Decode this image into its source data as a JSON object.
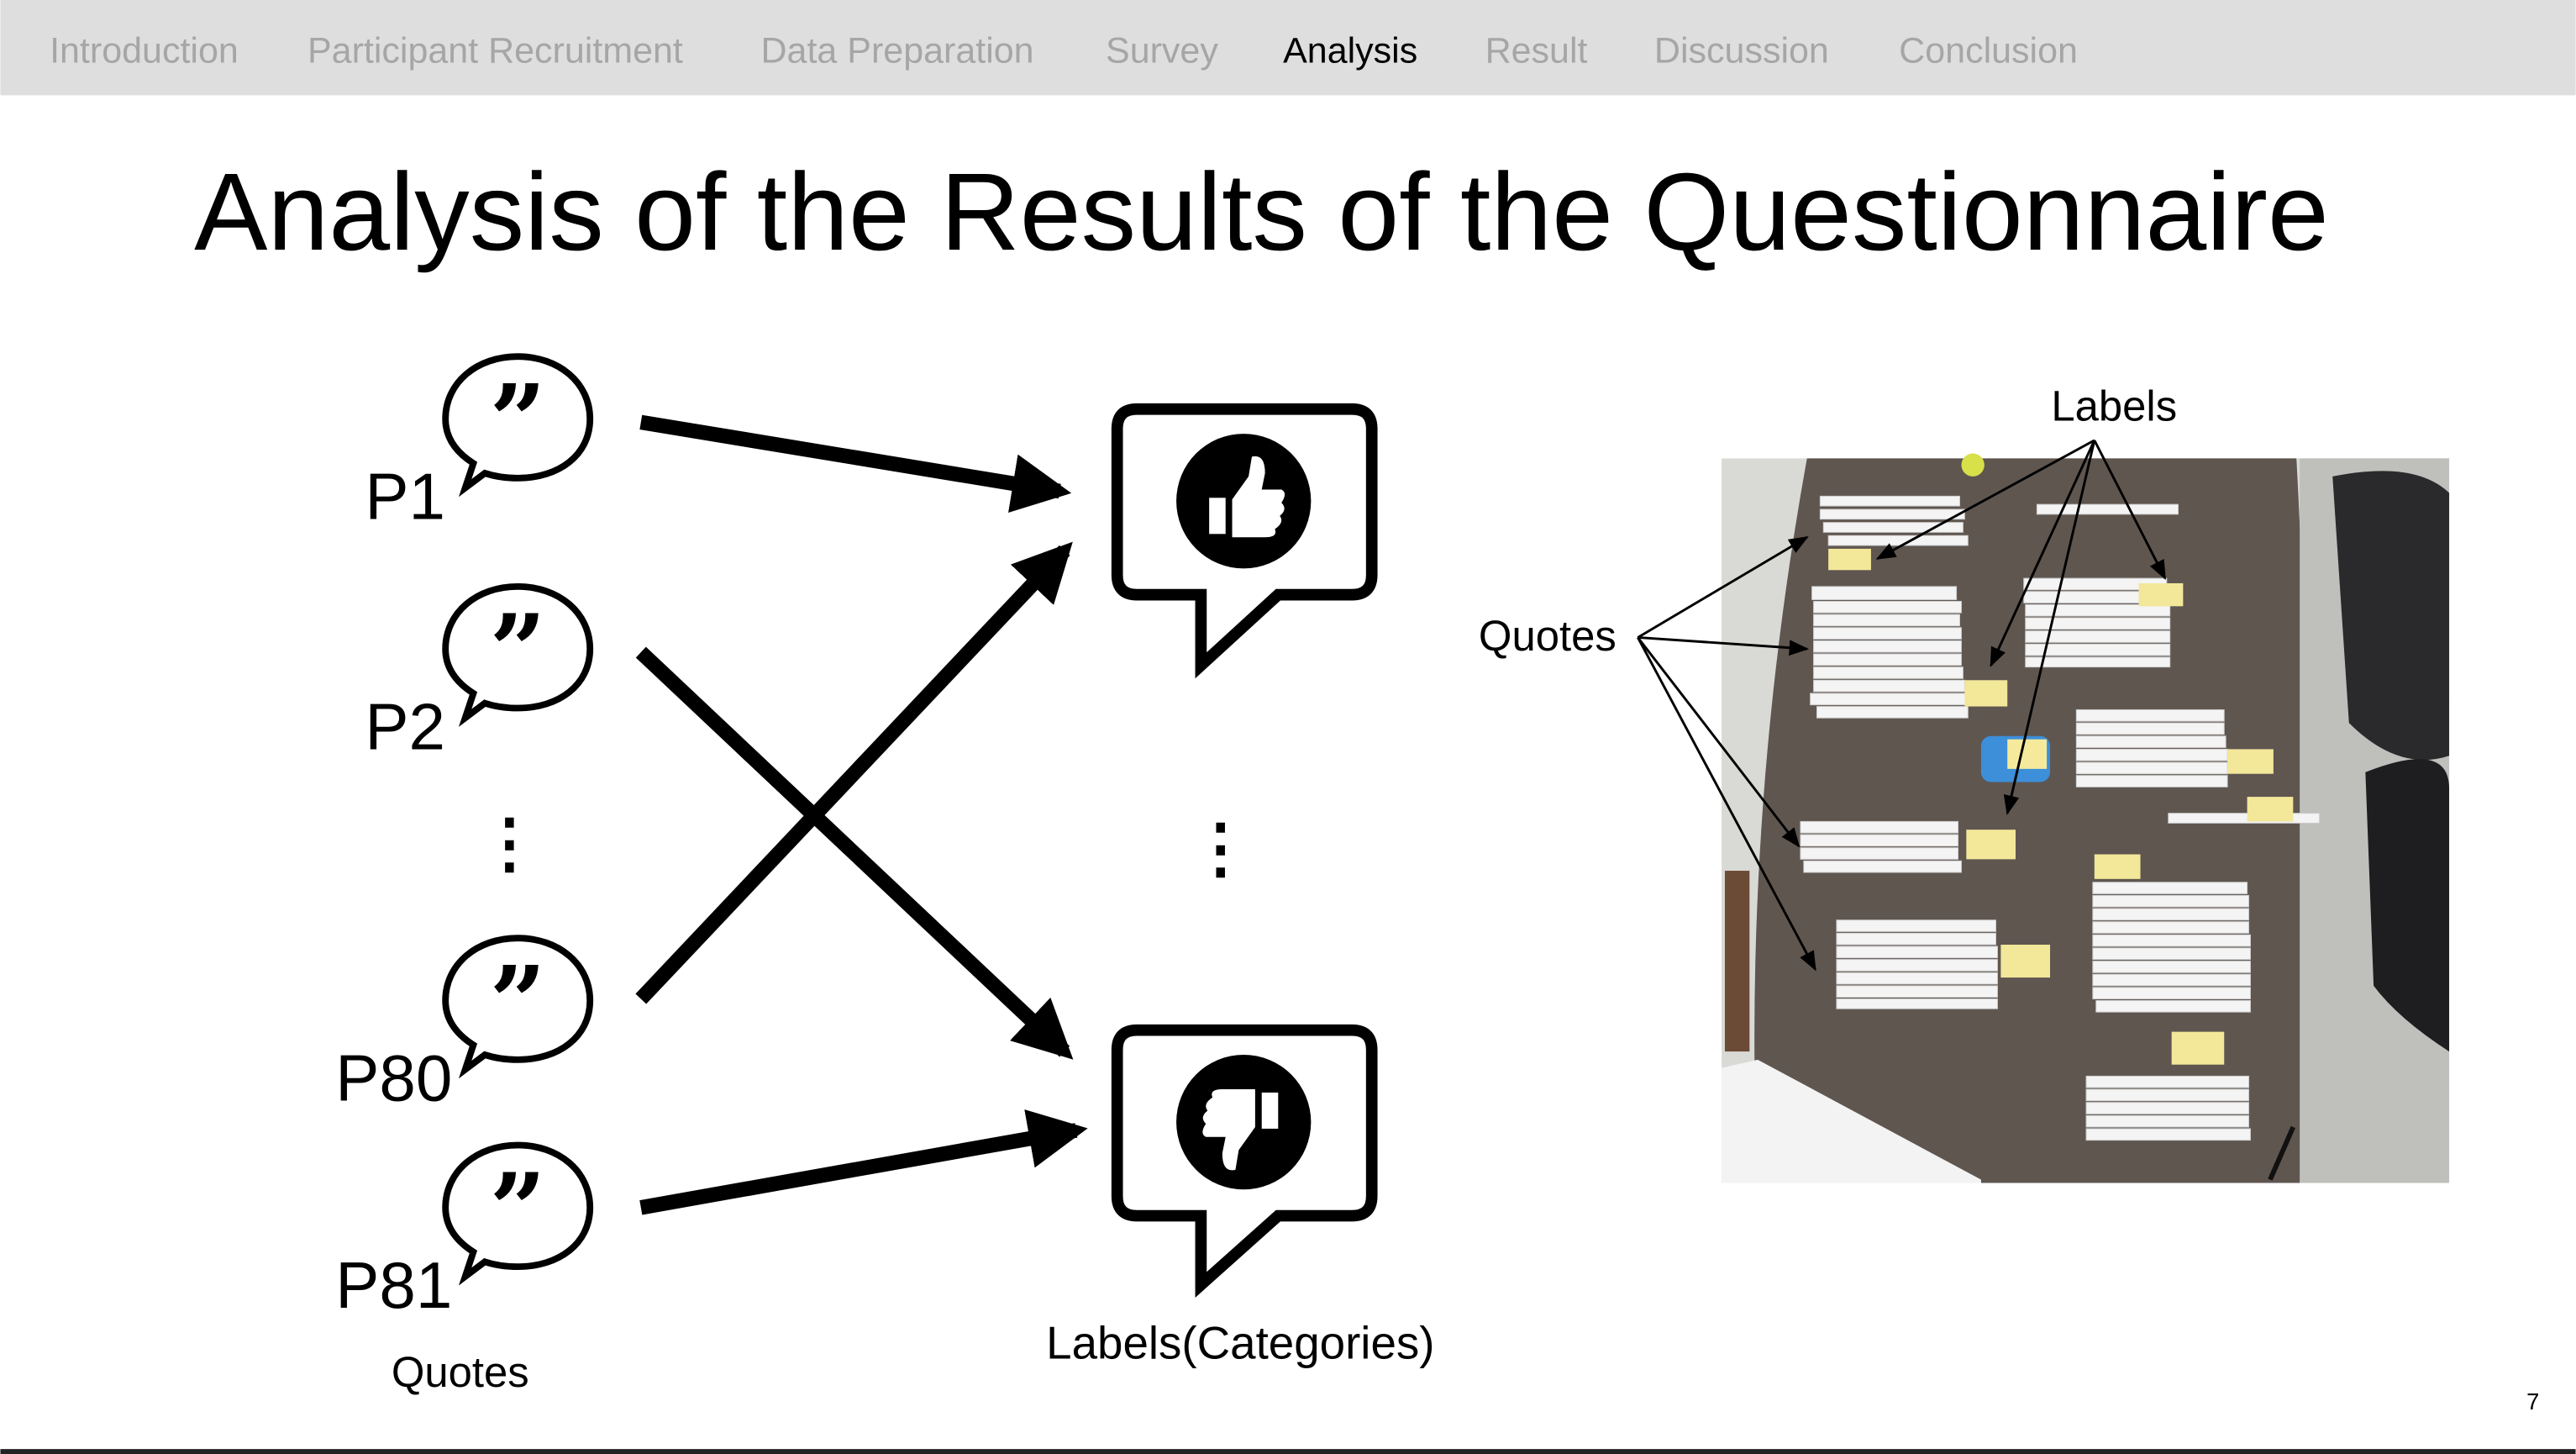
{
  "nav": {
    "items": [
      {
        "label": "Introduction",
        "active": false
      },
      {
        "label": "Participant Recruitment",
        "active": false
      },
      {
        "label": "Data Preparation",
        "active": false
      },
      {
        "label": "Survey",
        "active": false
      },
      {
        "label": "Analysis",
        "active": true
      },
      {
        "label": "Result",
        "active": false
      },
      {
        "label": "Discussion",
        "active": false
      },
      {
        "label": "Conclusion",
        "active": false
      }
    ]
  },
  "slide": {
    "title": "Analysis of the Results of the Questionnaire",
    "participants": [
      "P1",
      "P2",
      "P80",
      "P81"
    ],
    "ellipsis": "⋮",
    "quotes_caption": "Quotes",
    "labels_caption": "Labels(Categories)",
    "photo_labels_annotation": "Labels",
    "photo_quotes_annotation": "Quotes",
    "icons": [
      "quote-bubble-icon",
      "thumbs-up-icon",
      "thumbs-down-icon"
    ],
    "page_number": "7"
  },
  "colors": {
    "nav_bg": "#dedede",
    "nav_inactive": "#a6a6a6",
    "nav_active": "#000000",
    "table": "#5f5650"
  }
}
